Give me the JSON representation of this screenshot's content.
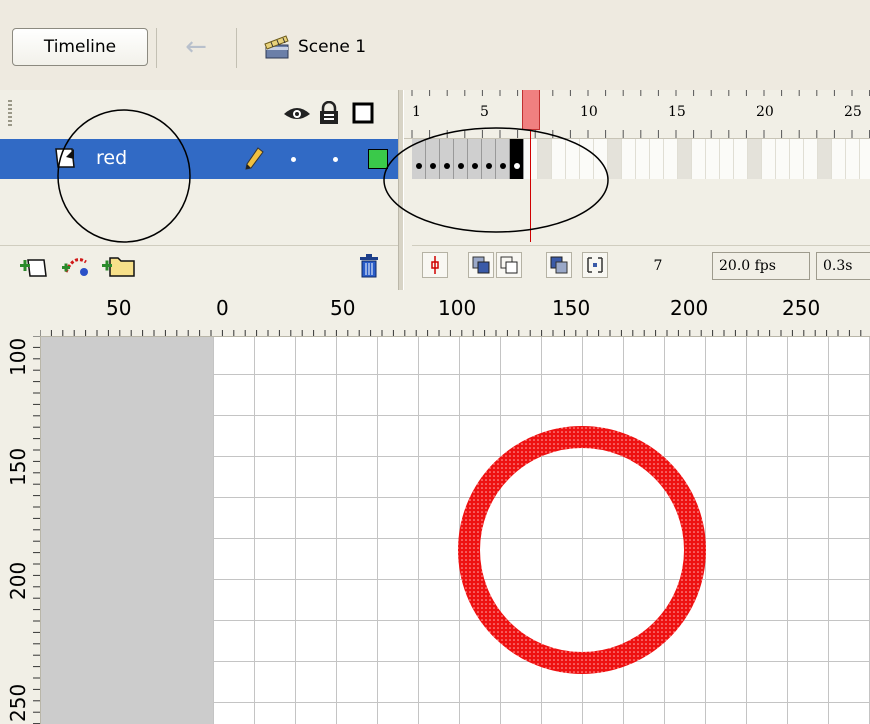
{
  "toolbar": {
    "timeline_label": "Timeline",
    "back_icon": "arrow-left-icon",
    "scene_icon": "clapperboard-icon",
    "scene_label": "Scene 1"
  },
  "layers": {
    "header_icons": [
      "eye-icon",
      "lock-icon",
      "outline-square-icon"
    ],
    "items": [
      {
        "name": "red",
        "outline_color": "#3ac94a",
        "selected": true
      }
    ],
    "bottom_icons": [
      "insert-layer-icon",
      "add-motion-guide-icon",
      "insert-folder-icon",
      "trash-icon"
    ]
  },
  "timeline": {
    "frame_numbers": [
      "1",
      "5",
      "10",
      "15",
      "20",
      "25"
    ],
    "current_frame": "7",
    "frame_rate": "20.0 fps",
    "elapsed": "0.3s",
    "filled_frames": 8,
    "playhead_color": "#f08080"
  },
  "stage": {
    "ruler_h": [
      "50",
      "0",
      "50",
      "100",
      "150",
      "200",
      "250"
    ],
    "ruler_v": [
      "100",
      "150",
      "200",
      "250"
    ],
    "shape_color": "#ee1111"
  }
}
